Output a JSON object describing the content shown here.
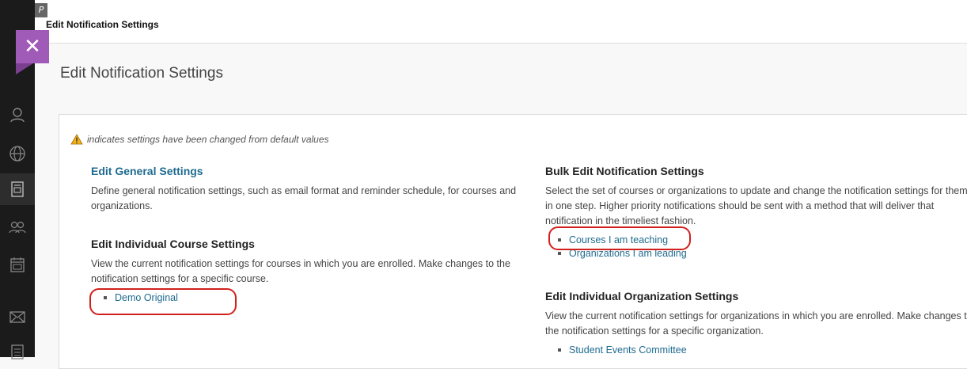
{
  "window": {
    "title": "Edit Notification Settings"
  },
  "page_title": "Edit Notification Settings",
  "note_text": "indicates settings have been changed from default values",
  "general": {
    "title": "Edit General Settings",
    "desc": "Define general notification settings, such as email format and reminder schedule, for courses and organizations."
  },
  "individual_course": {
    "title": "Edit Individual Course Settings",
    "desc": "View the current notification settings for courses in which you are enrolled. Make changes to the notification settings for a specific course.",
    "items": [
      "Demo Original"
    ]
  },
  "bulk": {
    "title": "Bulk Edit Notification Settings",
    "desc": "Select the set of courses or organizations to update and change the notification settings for them in one step. Higher priority notifications should be sent with a method that will deliver that notification in the timeliest fashion.",
    "items": [
      "Courses I am teaching",
      "Organizations I am leading"
    ]
  },
  "individual_org": {
    "title": "Edit Individual Organization Settings",
    "desc": "View the current notification settings for organizations in which you are enrolled. Make changes to the notification settings for a specific organization.",
    "items": [
      "Student Events Committee"
    ]
  },
  "icons": {
    "close": "close-icon",
    "pin": "pin-icon",
    "rail": [
      "user-icon",
      "globe-icon",
      "courses-icon",
      "groups-icon",
      "calendar-icon",
      "mail-icon",
      "grades-icon"
    ]
  },
  "colors": {
    "accent": "#a05ab8",
    "link": "#1e6b8f",
    "highlight": "#d0201c"
  }
}
